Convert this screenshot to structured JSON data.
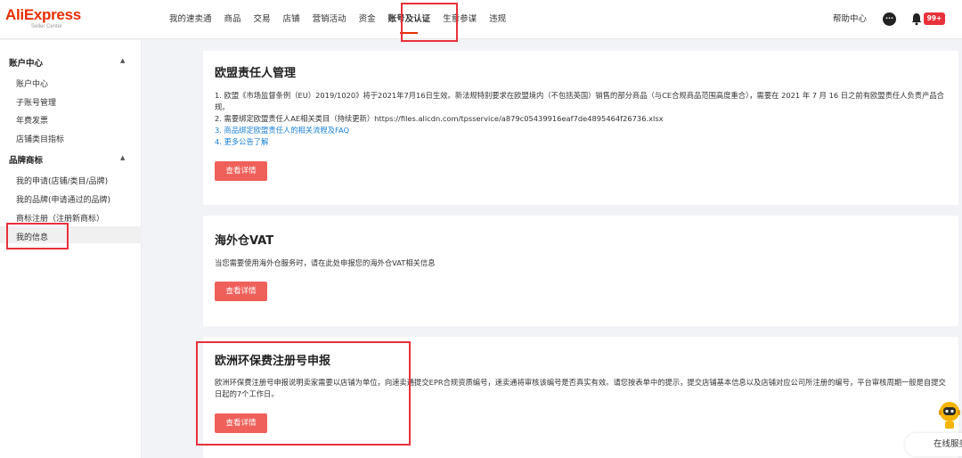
{
  "logo": {
    "brand": "AliExpress",
    "sub": "Seller Center"
  },
  "nav": {
    "items": [
      "我的速卖通",
      "商品",
      "交易",
      "店铺",
      "营销活动",
      "资金",
      "账号及认证",
      "生意参谋",
      "违规"
    ],
    "active_index": 6,
    "help": "帮助中心",
    "badge": "99+"
  },
  "sidebar": {
    "groups": [
      {
        "title": "账户中心",
        "items": [
          "账户中心",
          "子账号管理",
          "年费发票",
          "店铺类目指标"
        ]
      },
      {
        "title": "品牌商标",
        "items": [
          "我的申请(店铺/类目/品牌)",
          "我的品牌(申请通过的品牌)",
          "商标注册（注册新商标）",
          "我的信息"
        ]
      }
    ],
    "active_item": "我的信息"
  },
  "cards": [
    {
      "title": "欧盟责任人管理",
      "lines": [
        "1. 欧盟《市场监督条例（EU）2019/1020》将于2021年7月16日生效。新法规特别要求在欧盟境内（不包括英国）销售的部分商品（与CE合规商品范围高度重合），需要在 2021 年 7 月 16 日之前有欧盟责任人负责产品合规。",
        "2. 需要绑定欧盟责任人AE相关类目（持续更新）https://files.alicdn.com/tpsservice/a879c05439916eaf7de4895464f26736.xlsx"
      ],
      "links": [
        "3. 商品绑定欧盟责任人的相关流程及FAQ",
        "4. 更多公告了解"
      ],
      "button": "查看详情"
    },
    {
      "title": "海外仓VAT",
      "lines": [
        "当您需要使用海外仓服务时，请在此处申报您的海外仓VAT相关信息"
      ],
      "button": "查看详情"
    },
    {
      "title": "欧洲环保费注册号申报",
      "lines": [
        "欧洲环保费注册号申报说明卖家需要以店铺为单位，向速卖通提交EPR合规资质编号，速卖通将审核该编号是否真实有效。请您按表单中的提示，提交店铺基本信息以及店铺对应公司所注册的编号，平台审核周期一般是自提交日起的7个工作日。"
      ],
      "button": "查看详情"
    }
  ],
  "service": {
    "label": "在线服务"
  },
  "colors": {
    "brand": "#e62e04",
    "button": "#f0605a",
    "highlight": "#e8313a",
    "link": "#1a7fd6"
  },
  "icons": [
    "chat-icon",
    "bell-icon",
    "caret-up-icon",
    "robot-icon"
  ]
}
